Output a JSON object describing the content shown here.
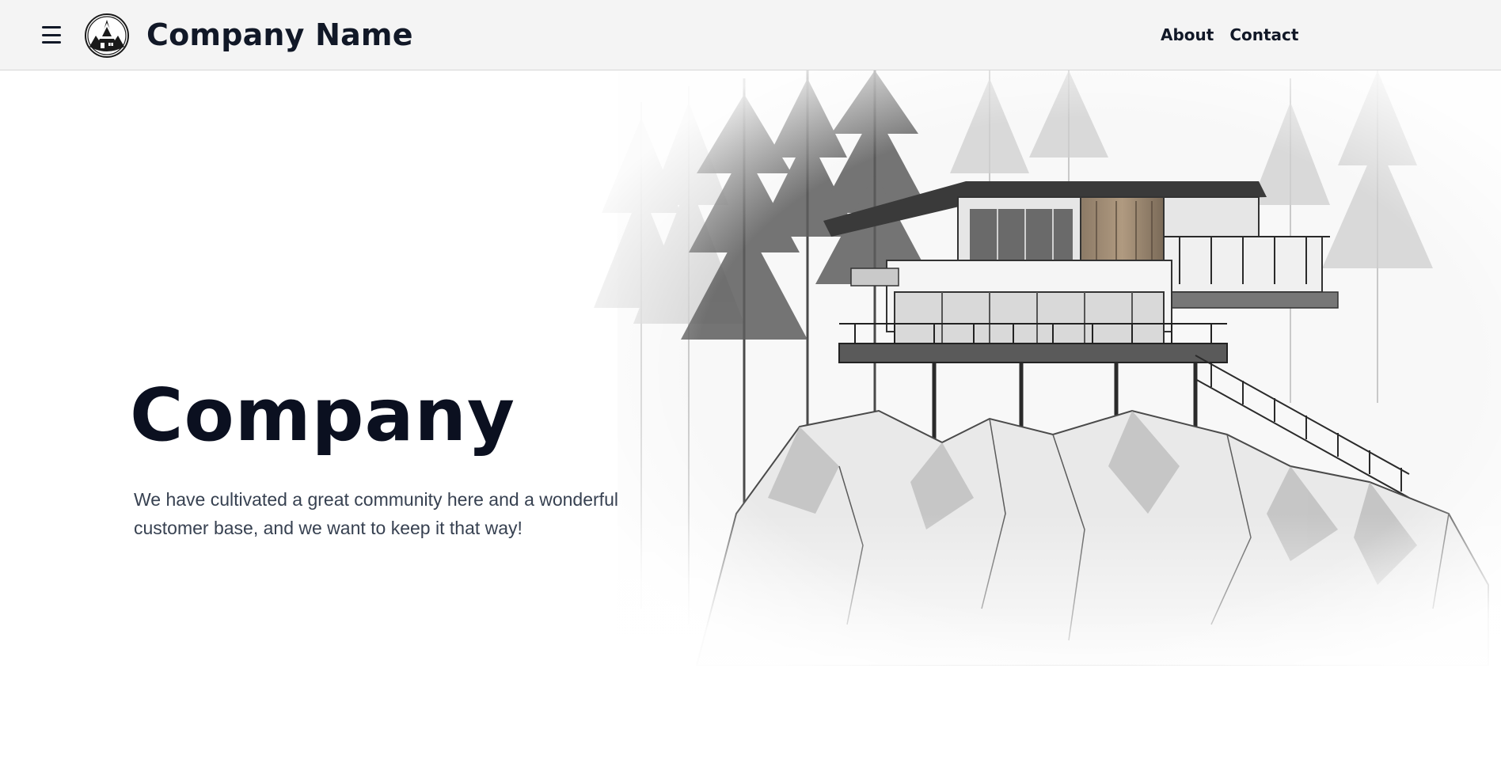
{
  "header": {
    "brand_name": "Company Name",
    "menu_icon": "hamburger-menu-icon",
    "logo_icon": "a-frame-cabin-logo-icon",
    "nav": [
      {
        "label": "About"
      },
      {
        "label": "Contact"
      }
    ]
  },
  "hero": {
    "title": "Company",
    "description": "We have cultivated a great community here and a wonderful customer base, and we want to keep it that way!",
    "image": "pencil-sketch-house-on-rocks-illustration"
  },
  "colors": {
    "header_bg": "#f4f4f4",
    "text_dark": "#111827",
    "text_body": "#374151",
    "page_bg": "#ffffff"
  }
}
